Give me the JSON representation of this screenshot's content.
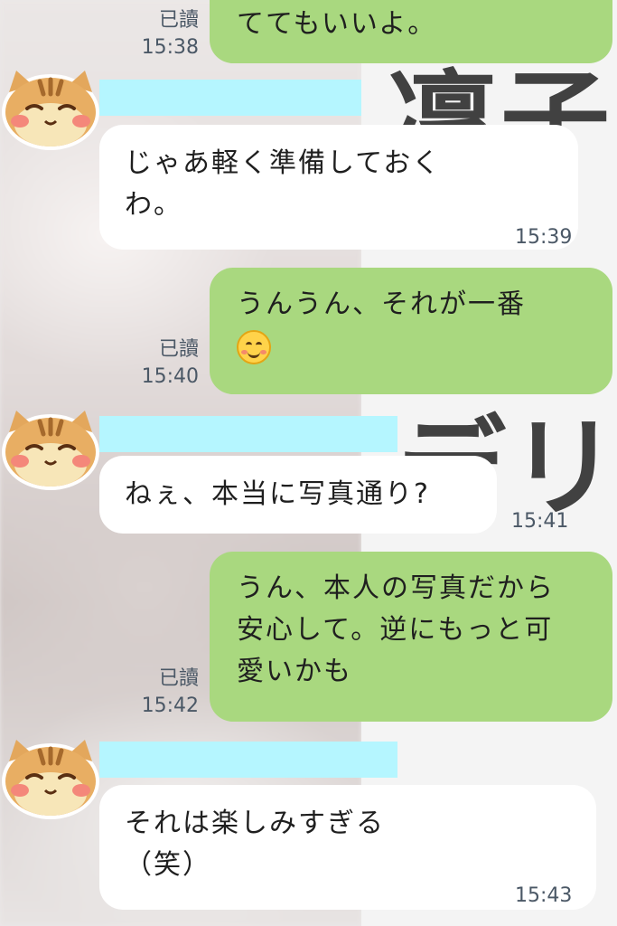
{
  "background": {
    "overlay_texts": [
      "凜子",
      "デリ"
    ]
  },
  "messages": [
    {
      "type": "out",
      "text": "ててもいいよ。",
      "read": "已讀",
      "time": "15:38"
    },
    {
      "type": "in",
      "lines": [
        "じゃあ軽く準備しておく",
        "わ。"
      ],
      "time": "15:39"
    },
    {
      "type": "out",
      "lines": [
        "うんうん、それが一番"
      ],
      "emoji": "smiling-face-icon",
      "read": "已讀",
      "time": "15:40"
    },
    {
      "type": "in",
      "lines": [
        "ねぇ、本当に写真通り?"
      ],
      "time": "15:41"
    },
    {
      "type": "out",
      "lines": [
        "うん、本人の写真だから",
        "安心して。逆にもっと可",
        "愛いかも"
      ],
      "read": "已讀",
      "time": "15:42"
    },
    {
      "type": "in",
      "lines": [
        "それは楽しみすぎる",
        "（笑）"
      ],
      "time": "15:43"
    }
  ],
  "colors": {
    "outgoing_bubble": "#a9d87f",
    "incoming_bubble": "#ffffff",
    "name_redaction": "#b5f6ff",
    "meta_text": "#4b5866"
  }
}
